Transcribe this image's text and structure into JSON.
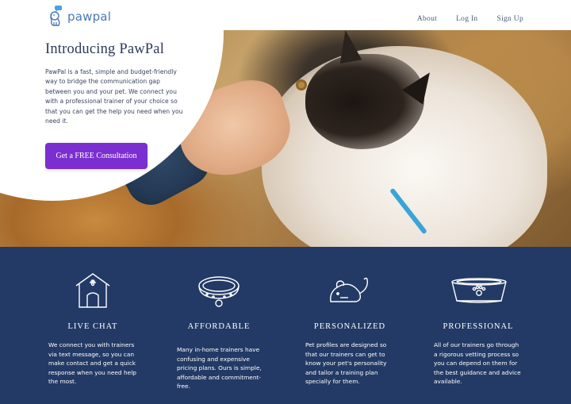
{
  "header": {
    "logo_text": "pawpal",
    "nav": {
      "about": "About",
      "login": "Log In",
      "signup": "Sign Up"
    }
  },
  "hero": {
    "title": "Introducing PawPal",
    "body": "PawPal is a fast, simple and budget-friendly way to bridge the communication gap between you and your pet. We connect you with a professional trainer of your choice so that you can get the help you need when you need it.",
    "cta_label": "Get a FREE Consultation"
  },
  "features": [
    {
      "title": "LIVE CHAT",
      "icon": "house-icon",
      "body": "We connect you with trainers via text message, so you can make contact and get a quick response when you need help the most."
    },
    {
      "title": "AFFORDABLE",
      "icon": "collar-icon",
      "body": "Many in-home trainers have confusing and expensive pricing plans. Ours is simple, affordable and commitment-free."
    },
    {
      "title": "PERSONALIZED",
      "icon": "mouse-toy-icon",
      "body": "Pet profiles are designed so that our trainers can get to know your pet's personality and tailor a training plan specially for them."
    },
    {
      "title": "PROFESSIONAL",
      "icon": "pet-bowl-icon",
      "body": "All of our trainers go through a rigorous vetting process so you can depend on them for the best guidance and advice available."
    }
  ],
  "colors": {
    "brand": "#4a78b8",
    "cta": "#7b2fd0",
    "features_bg": "#233a66",
    "heading": "#2c3a5a"
  }
}
